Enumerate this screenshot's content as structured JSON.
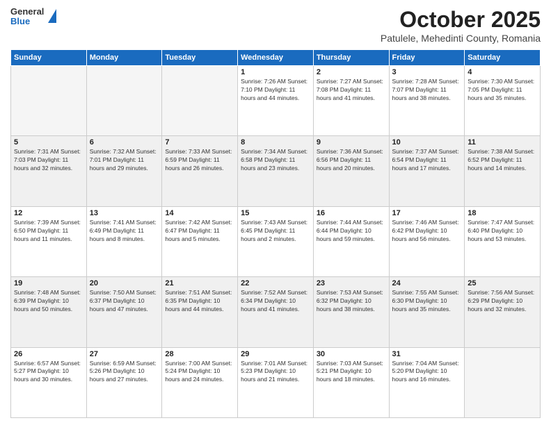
{
  "logo": {
    "general": "General",
    "blue": "Blue"
  },
  "header": {
    "month": "October 2025",
    "location": "Patulele, Mehedinti County, Romania"
  },
  "weekdays": [
    "Sunday",
    "Monday",
    "Tuesday",
    "Wednesday",
    "Thursday",
    "Friday",
    "Saturday"
  ],
  "weeks": [
    [
      {
        "num": "",
        "info": ""
      },
      {
        "num": "",
        "info": ""
      },
      {
        "num": "",
        "info": ""
      },
      {
        "num": "1",
        "info": "Sunrise: 7:26 AM\nSunset: 7:10 PM\nDaylight: 11 hours and 44 minutes."
      },
      {
        "num": "2",
        "info": "Sunrise: 7:27 AM\nSunset: 7:08 PM\nDaylight: 11 hours and 41 minutes."
      },
      {
        "num": "3",
        "info": "Sunrise: 7:28 AM\nSunset: 7:07 PM\nDaylight: 11 hours and 38 minutes."
      },
      {
        "num": "4",
        "info": "Sunrise: 7:30 AM\nSunset: 7:05 PM\nDaylight: 11 hours and 35 minutes."
      }
    ],
    [
      {
        "num": "5",
        "info": "Sunrise: 7:31 AM\nSunset: 7:03 PM\nDaylight: 11 hours and 32 minutes."
      },
      {
        "num": "6",
        "info": "Sunrise: 7:32 AM\nSunset: 7:01 PM\nDaylight: 11 hours and 29 minutes."
      },
      {
        "num": "7",
        "info": "Sunrise: 7:33 AM\nSunset: 6:59 PM\nDaylight: 11 hours and 26 minutes."
      },
      {
        "num": "8",
        "info": "Sunrise: 7:34 AM\nSunset: 6:58 PM\nDaylight: 11 hours and 23 minutes."
      },
      {
        "num": "9",
        "info": "Sunrise: 7:36 AM\nSunset: 6:56 PM\nDaylight: 11 hours and 20 minutes."
      },
      {
        "num": "10",
        "info": "Sunrise: 7:37 AM\nSunset: 6:54 PM\nDaylight: 11 hours and 17 minutes."
      },
      {
        "num": "11",
        "info": "Sunrise: 7:38 AM\nSunset: 6:52 PM\nDaylight: 11 hours and 14 minutes."
      }
    ],
    [
      {
        "num": "12",
        "info": "Sunrise: 7:39 AM\nSunset: 6:50 PM\nDaylight: 11 hours and 11 minutes."
      },
      {
        "num": "13",
        "info": "Sunrise: 7:41 AM\nSunset: 6:49 PM\nDaylight: 11 hours and 8 minutes."
      },
      {
        "num": "14",
        "info": "Sunrise: 7:42 AM\nSunset: 6:47 PM\nDaylight: 11 hours and 5 minutes."
      },
      {
        "num": "15",
        "info": "Sunrise: 7:43 AM\nSunset: 6:45 PM\nDaylight: 11 hours and 2 minutes."
      },
      {
        "num": "16",
        "info": "Sunrise: 7:44 AM\nSunset: 6:44 PM\nDaylight: 10 hours and 59 minutes."
      },
      {
        "num": "17",
        "info": "Sunrise: 7:46 AM\nSunset: 6:42 PM\nDaylight: 10 hours and 56 minutes."
      },
      {
        "num": "18",
        "info": "Sunrise: 7:47 AM\nSunset: 6:40 PM\nDaylight: 10 hours and 53 minutes."
      }
    ],
    [
      {
        "num": "19",
        "info": "Sunrise: 7:48 AM\nSunset: 6:39 PM\nDaylight: 10 hours and 50 minutes."
      },
      {
        "num": "20",
        "info": "Sunrise: 7:50 AM\nSunset: 6:37 PM\nDaylight: 10 hours and 47 minutes."
      },
      {
        "num": "21",
        "info": "Sunrise: 7:51 AM\nSunset: 6:35 PM\nDaylight: 10 hours and 44 minutes."
      },
      {
        "num": "22",
        "info": "Sunrise: 7:52 AM\nSunset: 6:34 PM\nDaylight: 10 hours and 41 minutes."
      },
      {
        "num": "23",
        "info": "Sunrise: 7:53 AM\nSunset: 6:32 PM\nDaylight: 10 hours and 38 minutes."
      },
      {
        "num": "24",
        "info": "Sunrise: 7:55 AM\nSunset: 6:30 PM\nDaylight: 10 hours and 35 minutes."
      },
      {
        "num": "25",
        "info": "Sunrise: 7:56 AM\nSunset: 6:29 PM\nDaylight: 10 hours and 32 minutes."
      }
    ],
    [
      {
        "num": "26",
        "info": "Sunrise: 6:57 AM\nSunset: 5:27 PM\nDaylight: 10 hours and 30 minutes."
      },
      {
        "num": "27",
        "info": "Sunrise: 6:59 AM\nSunset: 5:26 PM\nDaylight: 10 hours and 27 minutes."
      },
      {
        "num": "28",
        "info": "Sunrise: 7:00 AM\nSunset: 5:24 PM\nDaylight: 10 hours and 24 minutes."
      },
      {
        "num": "29",
        "info": "Sunrise: 7:01 AM\nSunset: 5:23 PM\nDaylight: 10 hours and 21 minutes."
      },
      {
        "num": "30",
        "info": "Sunrise: 7:03 AM\nSunset: 5:21 PM\nDaylight: 10 hours and 18 minutes."
      },
      {
        "num": "31",
        "info": "Sunrise: 7:04 AM\nSunset: 5:20 PM\nDaylight: 10 hours and 16 minutes."
      },
      {
        "num": "",
        "info": ""
      }
    ]
  ]
}
